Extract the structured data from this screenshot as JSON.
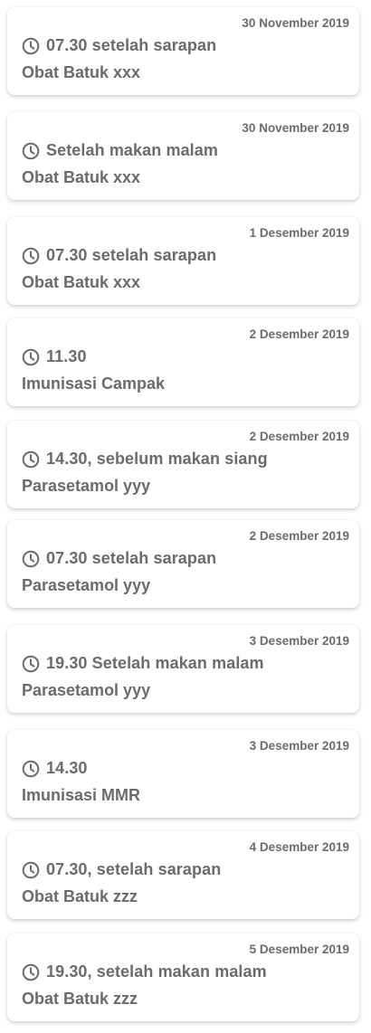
{
  "reminders": [
    {
      "date": "30 November 2019",
      "time": "07.30 setelah sarapan",
      "name": "Obat Batuk xxx"
    },
    {
      "date": "30 November 2019",
      "time": "Setelah makan malam",
      "name": "Obat Batuk xxx"
    },
    {
      "date": "1 Desember 2019",
      "time": "07.30 setelah sarapan",
      "name": "Obat Batuk xxx"
    },
    {
      "date": "2 Desember 2019",
      "time": "11.30",
      "name": "Imunisasi Campak"
    },
    {
      "date": "2 Desember 2019",
      "time": "14.30, sebelum makan siang",
      "name": "Parasetamol yyy"
    },
    {
      "date": "2 Desember 2019",
      "time": "07.30 setelah sarapan",
      "name": "Parasetamol yyy"
    },
    {
      "date": "3 Desember 2019",
      "time": "19.30 Setelah makan malam",
      "name": "Parasetamol yyy"
    },
    {
      "date": "3 Desember 2019",
      "time": "14.30",
      "name": "Imunisasi MMR"
    },
    {
      "date": "4 Desember 2019",
      "time": "07.30, setelah sarapan",
      "name": "Obat Batuk zzz"
    },
    {
      "date": "5 Desember 2019",
      "time": "19.30, setelah makan malam",
      "name": "Obat Batuk zzz"
    }
  ],
  "icons": {
    "time": "clock-icon"
  },
  "colors": {
    "text": "#6b6b6b",
    "card": "#ffffff"
  }
}
